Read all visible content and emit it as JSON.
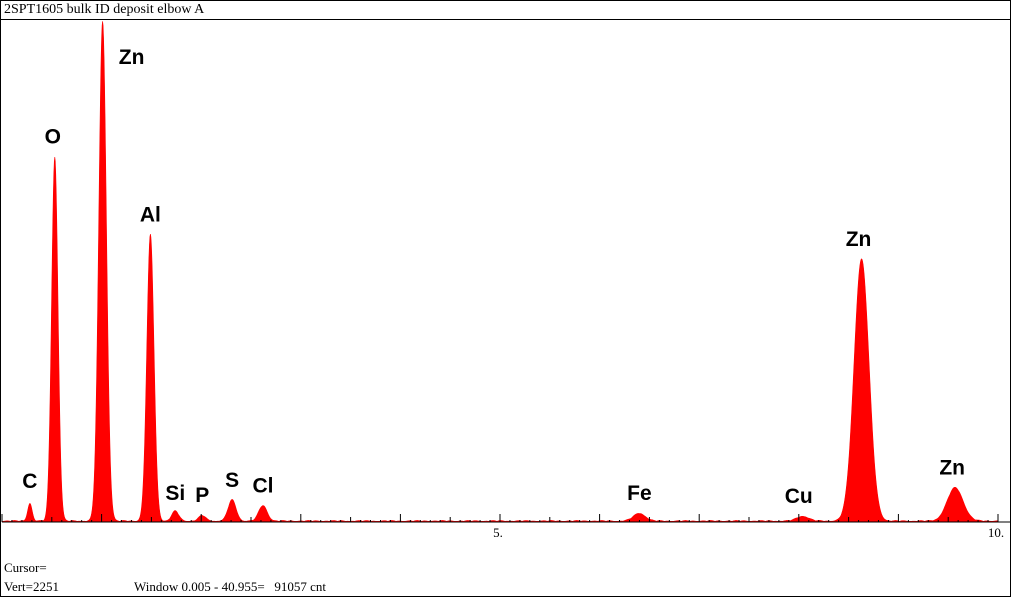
{
  "window": {
    "title": "2SPT1605 bulk ID deposit elbow A"
  },
  "status": {
    "cursor": "Cursor=",
    "vert": "Vert=2251",
    "window_range": "Window 0.005 - 40.955=   91057 cnt"
  },
  "colors": {
    "spectrum_fill": "#ff0000",
    "background": "#ffffff",
    "axis": "#000000"
  },
  "chart_data": {
    "type": "area",
    "title": "2SPT1605 bulk ID deposit elbow A",
    "xlabel": "",
    "ylabel": "",
    "xlim": [
      0,
      10
    ],
    "ylim": [
      0,
      2251
    ],
    "x_ticks": [
      {
        "value": 5,
        "label": "5."
      },
      {
        "value": 10,
        "label": "10."
      }
    ],
    "grid": false,
    "peaks": [
      {
        "label": "C",
        "energy": 0.28,
        "counts": 80,
        "sigma": 0.022
      },
      {
        "label": "O",
        "energy": 0.53,
        "counts": 1640,
        "sigma": 0.032
      },
      {
        "label": "Zn",
        "energy": 1.01,
        "counts": 2251,
        "sigma": 0.038
      },
      {
        "label": "Al",
        "energy": 1.49,
        "counts": 1290,
        "sigma": 0.036
      },
      {
        "label": "Si",
        "energy": 1.74,
        "counts": 45,
        "sigma": 0.035
      },
      {
        "label": "P",
        "energy": 2.01,
        "counts": 25,
        "sigma": 0.035
      },
      {
        "label": "S",
        "energy": 2.31,
        "counts": 95,
        "sigma": 0.04
      },
      {
        "label": "Cl",
        "energy": 2.62,
        "counts": 70,
        "sigma": 0.042
      },
      {
        "label": "Fe",
        "energy": 6.4,
        "counts": 35,
        "sigma": 0.06
      },
      {
        "label": "Cu",
        "energy": 8.04,
        "counts": 22,
        "sigma": 0.06
      },
      {
        "label": "Zn",
        "energy": 8.63,
        "counts": 1180,
        "sigma": 0.075
      },
      {
        "label": "Zn",
        "energy": 9.57,
        "counts": 150,
        "sigma": 0.08
      }
    ]
  }
}
